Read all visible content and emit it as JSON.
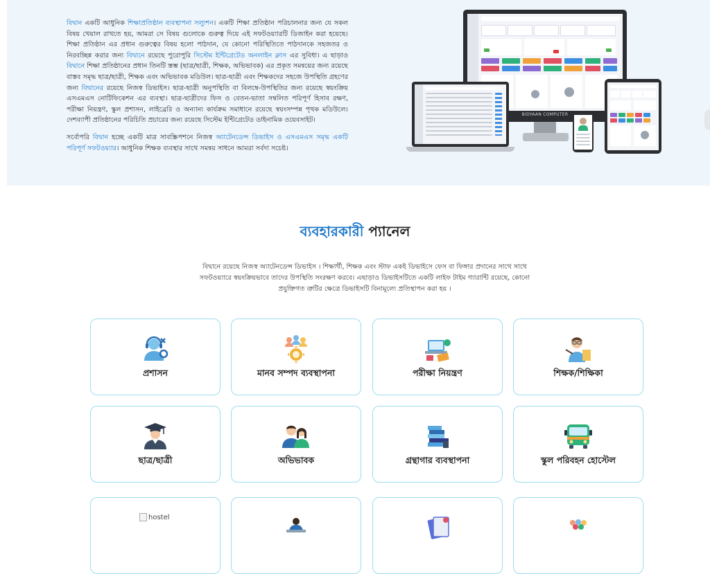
{
  "intro": {
    "p1": [
      {
        "t": "বিদ্বান",
        "hl": true
      },
      {
        "t": " একটি আধুনিক ",
        "hl": false
      },
      {
        "t": "শিক্ষাপ্রতিষ্ঠান ব্যবস্থাপনা সল্যুশন",
        "hl": true
      },
      {
        "t": "। একটি শিক্ষা প্রতিষ্ঠান পরিচালনার জন্য যে সকল বিষয় খেয়াল রাখতে হয়, আমরা সে বিষয় গুলোকে গুরুত্ব দিয়ে এই সফটওয়্যারটি ডিজাইন করা হয়েছে। শিক্ষা প্রতিষ্ঠান এর প্রধান গুরুত্বের বিষয় হলো পাঠদান, যে কোনো পরিস্থিতিতে পাঠদানকে সহজতর ও নিরবচ্ছিন্ন করার জন্য ",
        "hl": false
      },
      {
        "t": "বিদ্বানে",
        "hl": true
      },
      {
        "t": " রয়েছে পুরোপুরি ",
        "hl": false
      },
      {
        "t": "সিস্টেম ইন্টিগ্রেটেড অনলাইন ক্লাস",
        "hl": true
      },
      {
        "t": " এর সুবিধা। এ ছাড়াও ",
        "hl": false
      },
      {
        "t": "বিদ্বানে",
        "hl": true
      },
      {
        "t": " শিক্ষা প্রতিষ্ঠানের প্রধান তিনটি স্তম্ভ (ছাত্র/ছাত্রী, শিক্ষক, অভিভাবক) এর প্রকৃত সমন্বয়ের জন্য রয়েছে বাস্তব সমৃদ্ধ ছাত্র/ছাত্রী, শিক্ষক এবং অভিভাবক মডিউল। ছাত্র-ছাত্রী এবং শিক্ষকদের সহজে উপস্থিতি গ্রহণের জন্য ",
        "hl": false
      },
      {
        "t": "বিদ্বানের",
        "hl": true
      },
      {
        "t": " রয়েছে নিজস্ব ডিভাইস। ছাত্র-ছাত্রী অনুপস্থিতি বা বিলম্বে-উপস্থিতির জন্য রয়েছে স্বয়ংক্রিয় এসএমএস নোটিফিকেশন এর ব্যবস্থা। ছাত্র-ছাত্রীদের ফিস ও বেতন-ভাতা সম্বলিত পরিপূর্ণ হিসাব রক্ষণ, পরীক্ষা নিয়ন্ত্রণ, স্কুল প্রশাসন, লাইব্রেরি ও অন্যান্য কার্যক্রম সমাধানে রয়েছে স্বয়ংসম্পন্ন পৃথক মডিউলে। দেশব্যাপী প্রতিষ্ঠানের পরিচিতি প্রচারের জন্য রয়েছে সিস্টেম ইন্টিগ্রেটেড ডাইনামিক ওয়েবসাইট।",
        "hl": false
      }
    ],
    "p2": [
      {
        "t": "সর্বোপরি ",
        "hl": false
      },
      {
        "t": "বিদ্বান",
        "hl": true
      },
      {
        "t": " হচ্ছে একটি মাত্র সাবস্ক্রিপশনে নিজস্ব ",
        "hl": false
      },
      {
        "t": "অ্যাটেনডেন্স ডিভাইস ও এসএমএস সমৃদ্ধ একটি পরিপূর্ণ সফটওয়্যার",
        "hl": true
      },
      {
        "t": "। আধুনিক শিক্ষক ব্যবস্থার সাথে সমন্বয় সাধনে আমরা সর্বদা সচেষ্ট।",
        "hl": false
      }
    ]
  },
  "devices": {
    "monitor_brand": "BIDYAAN COMPUTER"
  },
  "section": {
    "title_accent": "ব্যবহারকারী",
    "title_rest": " প্যানেল",
    "description": "বিদ্বানে রয়েছে নিজস্ব অ্যাটেনডেন্স ডিভাইস । শিক্ষার্থী, শিক্ষক এবং স্টাফ একই ডিভাইসে ফেস বা ফিঙ্গার প্রদানের সাথে সাথে সফটওয়্যারে স্বয়ংক্রিয়ভাবে তাদের উপস্থিতি সংরক্ষণ করবে। এছাড়াও ডিভাইসটিতে একটি লাইফ টাইম গ্যারান্টি রয়েছে, কোনো প্রযুক্তিগত ত্রুটির ক্ষেত্রে ডিভাইসটি বিনামূল্যে প্রতিস্থাপন করা হয় ।"
  },
  "cards": [
    {
      "label": "প্রশাসন",
      "icon": "admin-support-icon"
    },
    {
      "label": "মানব সম্পদ ব্যবস্থাপনা",
      "icon": "human-resource-icon"
    },
    {
      "label": "পরীক্ষা নিয়ন্ত্রণ",
      "icon": "exam-control-icon"
    },
    {
      "label": "শিক্ষক/শিক্ষিকা",
      "icon": "teacher-icon"
    },
    {
      "label": "ছাত্র/ছাত্রী",
      "icon": "student-graduate-icon"
    },
    {
      "label": "অভিভাবক",
      "icon": "guardian-icon"
    },
    {
      "label": "গ্রন্থাগার ব্যবস্থাপনা",
      "icon": "library-books-icon"
    },
    {
      "label": "স্কুল পরিবহন হোস্টেল",
      "icon": "school-bus-icon"
    },
    {
      "label": "",
      "icon": "hostel-icon",
      "alt": "hostel"
    },
    {
      "label": "",
      "icon": "office-desk-icon"
    },
    {
      "label": "",
      "icon": "documents-icon"
    },
    {
      "label": "",
      "icon": "group-people-icon"
    }
  ]
}
